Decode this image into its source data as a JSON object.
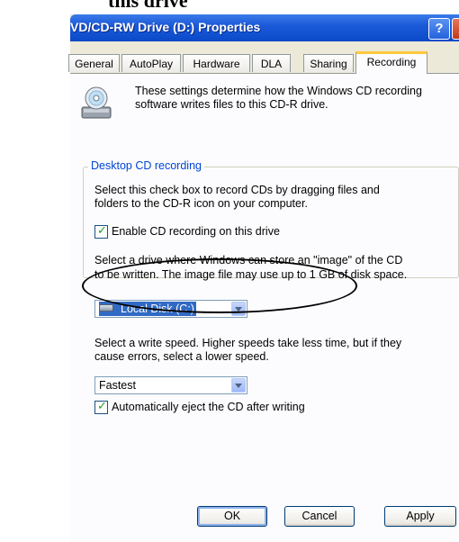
{
  "caption": "this drive",
  "window": {
    "title": "VD/CD-RW Drive (D:) Properties",
    "help_glyph": "?",
    "close_glyph": "X"
  },
  "tabs": [
    "General",
    "AutoPlay",
    "Hardware",
    "DLA",
    "Sharing",
    "Recording"
  ],
  "active_tab": "Recording",
  "recording": {
    "intro_line1": "These settings determine how the Windows CD recording",
    "intro_line2": "software writes files to this CD-R drive.",
    "group_title": "Desktop CD recording",
    "group_desc_line1": "Select this check box to record CDs by dragging files and",
    "group_desc_line2": "folders to the CD-R icon on your computer.",
    "enable_label": "Enable CD recording on this drive",
    "enable_checked": true,
    "image_desc_line1": "Select a drive where Windows can store an \"image\" of the CD",
    "image_desc_line2": "to be written. The image file may use up to 1 GB of disk space.",
    "image_drive_value": "Local Disk (C:)",
    "speed_desc_line1": "Select a write speed.  Higher speeds take less time, but if they",
    "speed_desc_line2": "cause errors, select a lower speed.",
    "speed_value": "Fastest",
    "eject_label": "Automatically eject the CD after writing",
    "eject_checked": true
  },
  "buttons": {
    "ok": "OK",
    "cancel": "Cancel",
    "apply": "Apply"
  },
  "colors": {
    "titlebar": "#0a49c8",
    "group_title": "#0046d5",
    "tab_highlight": "#ffc83c",
    "selection": "#316ac5"
  }
}
